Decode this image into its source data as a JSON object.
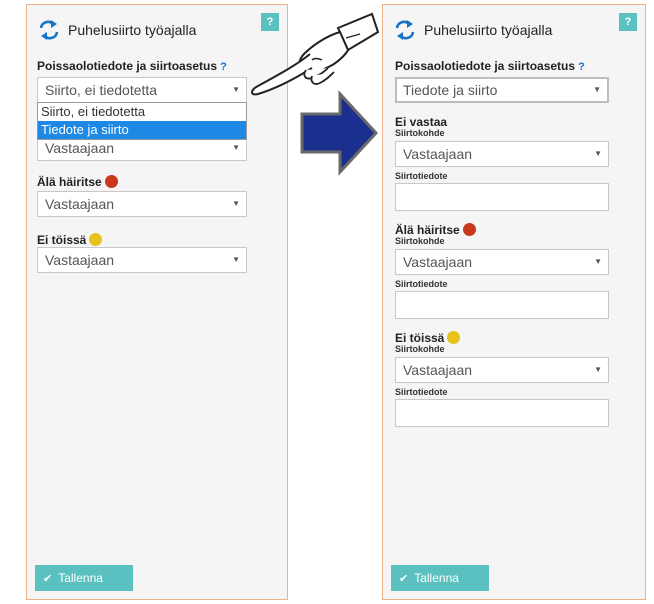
{
  "panel": {
    "title": "Puhelusiirto työajalla",
    "help": "?",
    "settings_label": "Poissaolotiedote ja siirtoasetus",
    "settings_help": "?",
    "transfer_label": "Siirtokohde",
    "note_label": "Siirtotiedote",
    "save_label": "Tallenna",
    "colors": {
      "accent": "#5bc0c0",
      "busy": "#c8391b",
      "away": "#e6c21a",
      "highlight": "#1e88e5"
    }
  },
  "left": {
    "settings_value": "Siirto, ei tiedotetta",
    "dropdown_options": [
      "Siirto, ei tiedotetta",
      "Tiedote ja siirto"
    ],
    "sections": [
      {
        "label": "",
        "value": "Vastaajaan"
      },
      {
        "label": "Älä häiritse",
        "value": "Vastaajaan"
      },
      {
        "label": "Ei töissä",
        "value": "Vastaajaan"
      }
    ]
  },
  "right": {
    "settings_value": "Tiedote ja siirto",
    "sections": [
      {
        "label": "Ei vastaa",
        "value": "Vastaajaan"
      },
      {
        "label": "Älä häiritse",
        "value": "Vastaajaan"
      },
      {
        "label": "Ei töissä",
        "value": "Vastaajaan"
      }
    ]
  },
  "icons": [
    "refresh-arrows-icon",
    "pointing-hand-icon",
    "right-arrow-icon",
    "check-icon",
    "chevron-down-icon"
  ]
}
